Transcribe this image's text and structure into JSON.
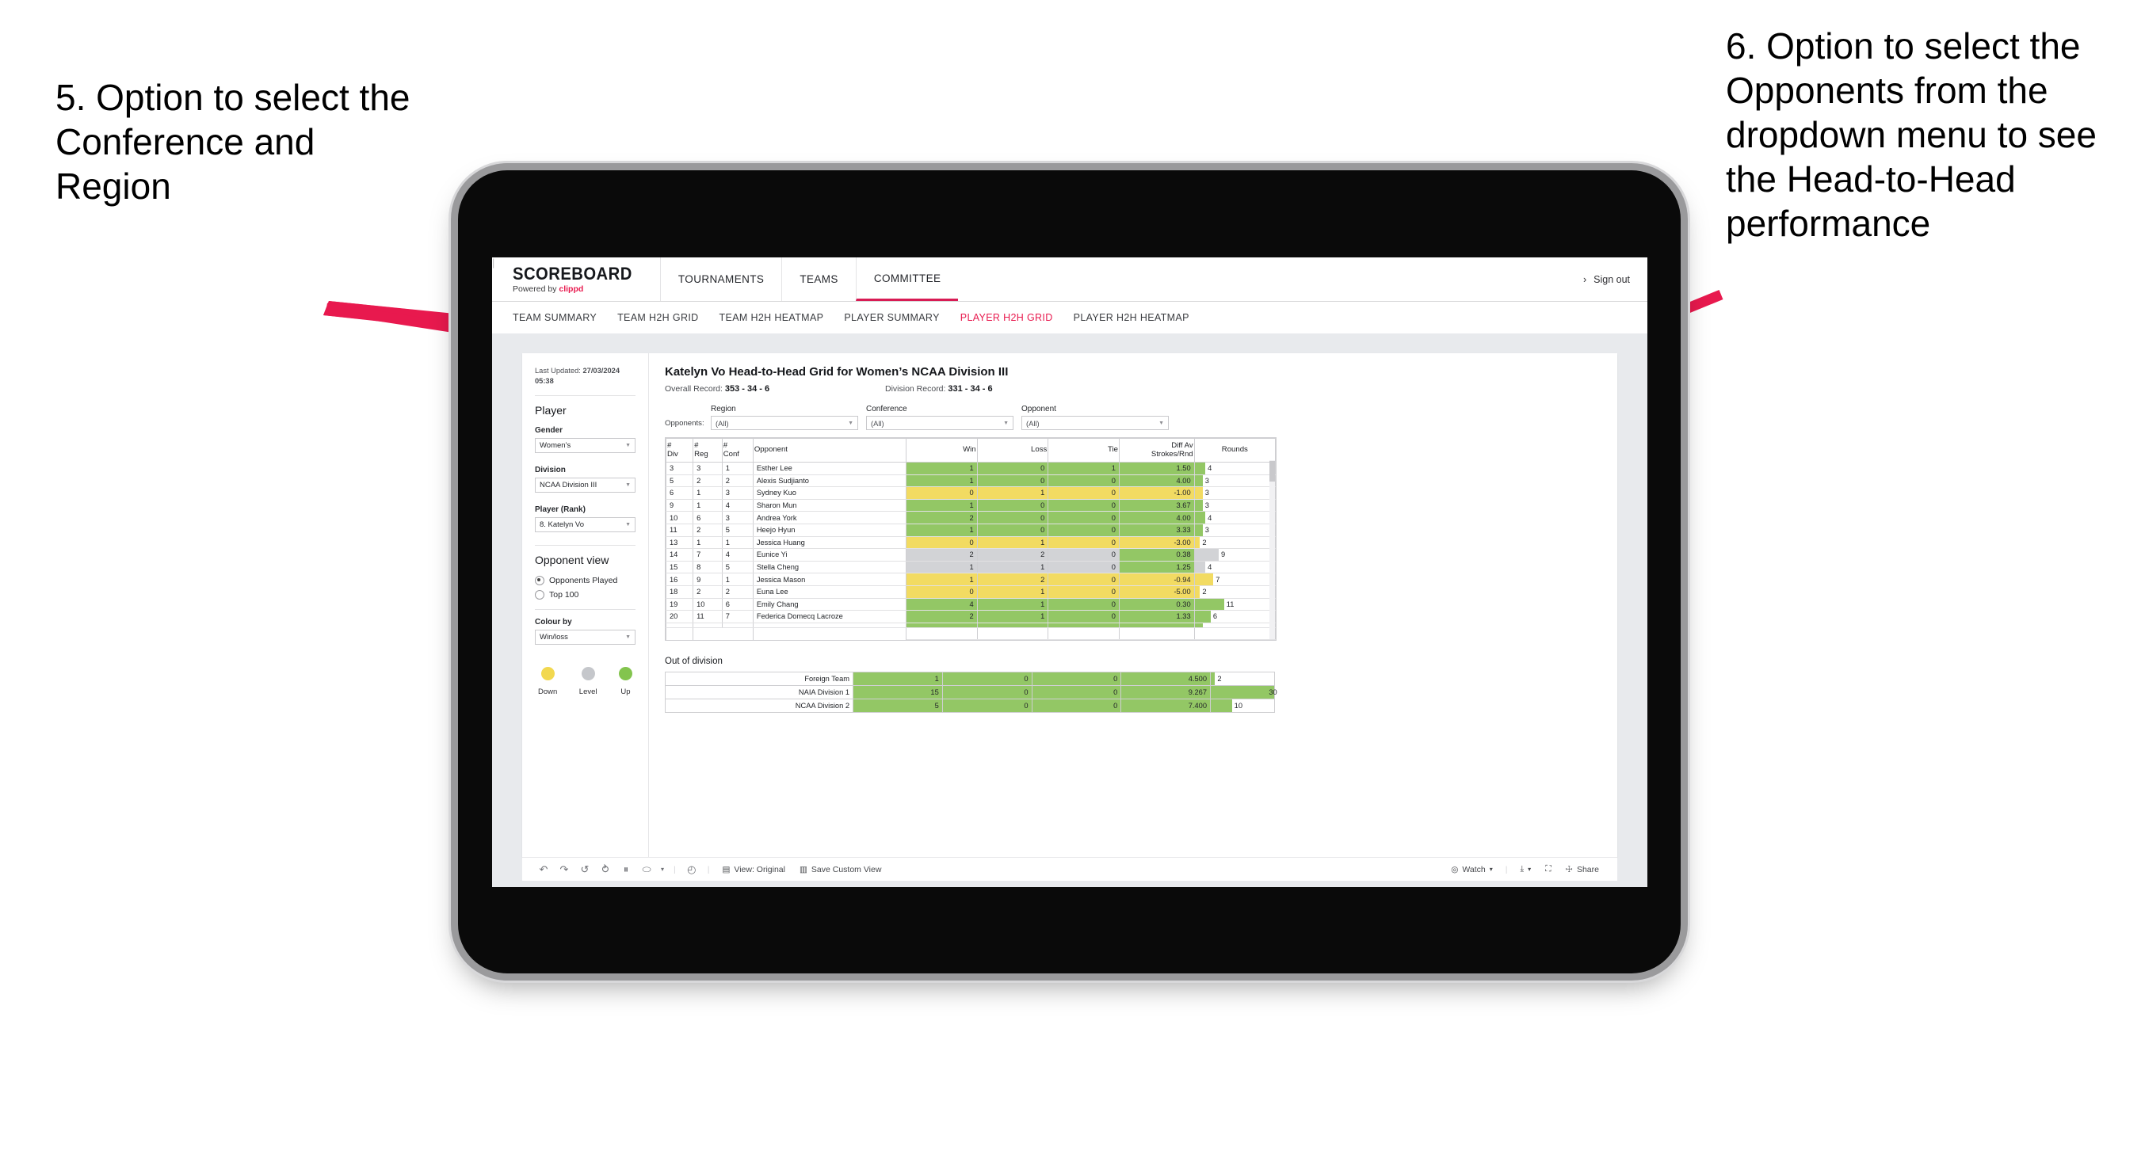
{
  "annotations": {
    "left": "5. Option to select the Conference and Region",
    "right": "6. Option to select the Opponents from the dropdown menu to see the Head-to-Head performance",
    "arrow_color": "#e8194e"
  },
  "app": {
    "logo_word": "SCOREBOARD",
    "logo_powered_prefix": "Powered by ",
    "logo_brand": "clippd",
    "main_nav": [
      {
        "label": "TOURNAMENTS",
        "active": false
      },
      {
        "label": "TEAMS",
        "active": false
      },
      {
        "label": "COMMITTEE",
        "active": true
      }
    ],
    "header_right": {
      "user_glyph": "›",
      "divider": "|",
      "sign_out": "Sign out"
    },
    "sub_nav": [
      {
        "label": "TEAM SUMMARY",
        "active": false
      },
      {
        "label": "TEAM H2H GRID",
        "active": false
      },
      {
        "label": "TEAM H2H HEATMAP",
        "active": false
      },
      {
        "label": "PLAYER SUMMARY",
        "active": false
      },
      {
        "label": "PLAYER H2H GRID",
        "active": true
      },
      {
        "label": "PLAYER H2H HEATMAP",
        "active": false
      }
    ],
    "accent_color": "#e8194e"
  },
  "sidebar": {
    "last_updated_label": "Last Updated: ",
    "last_updated_value": "27/03/2024",
    "last_updated_time": "05:38",
    "player_section_title": "Player",
    "gender": {
      "label": "Gender",
      "value": "Women’s"
    },
    "division": {
      "label": "Division",
      "value": "NCAA Division III"
    },
    "player_rank": {
      "label": "Player (Rank)",
      "value": "8. Katelyn Vo"
    },
    "opponent_view": {
      "title": "Opponent view",
      "options": [
        {
          "label": "Opponents Played",
          "selected": true
        },
        {
          "label": "Top 100",
          "selected": false
        }
      ]
    },
    "colour_by": {
      "label": "Colour by",
      "value": "Win/loss"
    },
    "legend": [
      {
        "label": "Down",
        "color": "#f2d84f"
      },
      {
        "label": "Level",
        "color": "#c5c7cb"
      },
      {
        "label": "Up",
        "color": "#83c44e"
      }
    ]
  },
  "main": {
    "title": "Katelyn Vo Head-to-Head Grid for Women’s NCAA Division III",
    "overall_record_label": "Overall Record: ",
    "overall_record_value": "353 - 34 - 6",
    "division_record_label": "Division Record: ",
    "division_record_value": "331 -  34 - 6",
    "opponents_label": "Opponents:",
    "filters": [
      {
        "name": "region",
        "label": "Region",
        "value": "(All)"
      },
      {
        "name": "conference",
        "label": "Conference",
        "value": "(All)"
      },
      {
        "name": "opponent",
        "label": "Opponent",
        "value": "(All)"
      }
    ],
    "out_of_division_title": "Out of division"
  },
  "chart_data": {
    "type": "table",
    "title": "Katelyn Vo Head-to-Head Grid for Women’s NCAA Division III",
    "columns": [
      "# Div",
      "# Reg",
      "# Conf",
      "Opponent",
      "Win",
      "Loss",
      "Tie",
      "Diff Av Strokes/Rnd",
      "Rounds"
    ],
    "column_headers_split": [
      {
        "l1": "#",
        "l2": "Div"
      },
      {
        "l1": "#",
        "l2": "Reg"
      },
      {
        "l1": "#",
        "l2": "Conf"
      },
      {
        "l1": "Opponent",
        "l2": ""
      },
      {
        "l1": "Win",
        "l2": ""
      },
      {
        "l1": "Loss",
        "l2": ""
      },
      {
        "l1": "Tie",
        "l2": ""
      },
      {
        "l1": "Diff Av",
        "l2": "Strokes/Rnd"
      },
      {
        "l1": "Rounds",
        "l2": ""
      }
    ],
    "rounds_max": 30,
    "colors": {
      "up": "#93c765",
      "down": "#f2db62",
      "level": "#d2d3d6"
    },
    "rows": [
      {
        "div": "3",
        "reg": "3",
        "conf": "1",
        "opponent": "Esther Lee",
        "win": "1",
        "loss": "0",
        "tie": "1",
        "diff": "1.50",
        "rounds": 4,
        "state": "up"
      },
      {
        "div": "5",
        "reg": "2",
        "conf": "2",
        "opponent": "Alexis Sudjianto",
        "win": "1",
        "loss": "0",
        "tie": "0",
        "diff": "4.00",
        "rounds": 3,
        "state": "up"
      },
      {
        "div": "6",
        "reg": "1",
        "conf": "3",
        "opponent": "Sydney Kuo",
        "win": "0",
        "loss": "1",
        "tie": "0",
        "diff": "-1.00",
        "rounds": 3,
        "state": "down"
      },
      {
        "div": "9",
        "reg": "1",
        "conf": "4",
        "opponent": "Sharon Mun",
        "win": "1",
        "loss": "0",
        "tie": "0",
        "diff": "3.67",
        "rounds": 3,
        "state": "up"
      },
      {
        "div": "10",
        "reg": "6",
        "conf": "3",
        "opponent": "Andrea York",
        "win": "2",
        "loss": "0",
        "tie": "0",
        "diff": "4.00",
        "rounds": 4,
        "state": "up"
      },
      {
        "div": "11",
        "reg": "2",
        "conf": "5",
        "opponent": "Heejo Hyun",
        "win": "1",
        "loss": "0",
        "tie": "0",
        "diff": "3.33",
        "rounds": 3,
        "state": "up"
      },
      {
        "div": "13",
        "reg": "1",
        "conf": "1",
        "opponent": "Jessica Huang",
        "win": "0",
        "loss": "1",
        "tie": "0",
        "diff": "-3.00",
        "rounds": 2,
        "state": "down"
      },
      {
        "div": "14",
        "reg": "7",
        "conf": "4",
        "opponent": "Eunice Yi",
        "win": "2",
        "loss": "2",
        "tie": "0",
        "diff": "0.38",
        "rounds": 9,
        "state": "level",
        "diff_state": "up"
      },
      {
        "div": "15",
        "reg": "8",
        "conf": "5",
        "opponent": "Stella Cheng",
        "win": "1",
        "loss": "1",
        "tie": "0",
        "diff": "1.25",
        "rounds": 4,
        "state": "level",
        "diff_state": "up"
      },
      {
        "div": "16",
        "reg": "9",
        "conf": "1",
        "opponent": "Jessica Mason",
        "win": "1",
        "loss": "2",
        "tie": "0",
        "diff": "-0.94",
        "rounds": 7,
        "state": "down"
      },
      {
        "div": "18",
        "reg": "2",
        "conf": "2",
        "opponent": "Euna Lee",
        "win": "0",
        "loss": "1",
        "tie": "0",
        "diff": "-5.00",
        "rounds": 2,
        "state": "down"
      },
      {
        "div": "19",
        "reg": "10",
        "conf": "6",
        "opponent": "Emily Chang",
        "win": "4",
        "loss": "1",
        "tie": "0",
        "diff": "0.30",
        "rounds": 11,
        "state": "up"
      },
      {
        "div": "20",
        "reg": "11",
        "conf": "7",
        "opponent": "Federica Domecq Lacroze",
        "win": "2",
        "loss": "1",
        "tie": "0",
        "diff": "1.33",
        "rounds": 6,
        "state": "up"
      }
    ],
    "out_of_division": {
      "rounds_max": 30,
      "rows": [
        {
          "name": "Foreign Team",
          "win": "1",
          "loss": "0",
          "tie": "0",
          "diff": "4.500",
          "rounds": 2,
          "state": "up"
        },
        {
          "name": "NAIA Division 1",
          "win": "15",
          "loss": "0",
          "tie": "0",
          "diff": "9.267",
          "rounds": 30,
          "state": "up"
        },
        {
          "name": "NCAA Division 2",
          "win": "5",
          "loss": "0",
          "tie": "0",
          "diff": "7.400",
          "rounds": 10,
          "state": "up"
        }
      ]
    }
  },
  "toolbar": {
    "icons": [
      {
        "name": "undo-icon",
        "glyph": "↶"
      },
      {
        "name": "redo-icon",
        "glyph": "↷"
      },
      {
        "name": "revert-icon",
        "glyph": "↺"
      },
      {
        "name": "refresh-data-icon",
        "glyph": "⥁"
      },
      {
        "name": "pause-updates-icon",
        "glyph": "⏸"
      },
      {
        "name": "highlight-icon",
        "glyph": "⬭"
      },
      {
        "name": "highlight-caret",
        "glyph": "▾"
      }
    ],
    "clock_icon": "◴",
    "view_original": {
      "icon": "▤",
      "label": "View: Original"
    },
    "save_custom_view": {
      "icon": "▥",
      "label": "Save Custom View"
    },
    "watch": {
      "icon": "◎",
      "label": "Watch",
      "caret": "▾"
    },
    "download": {
      "icon": "⤓",
      "caret": "▾"
    },
    "fullscreen": {
      "icon": "⛶"
    },
    "share": {
      "icon": "☩",
      "label": "Share"
    }
  }
}
